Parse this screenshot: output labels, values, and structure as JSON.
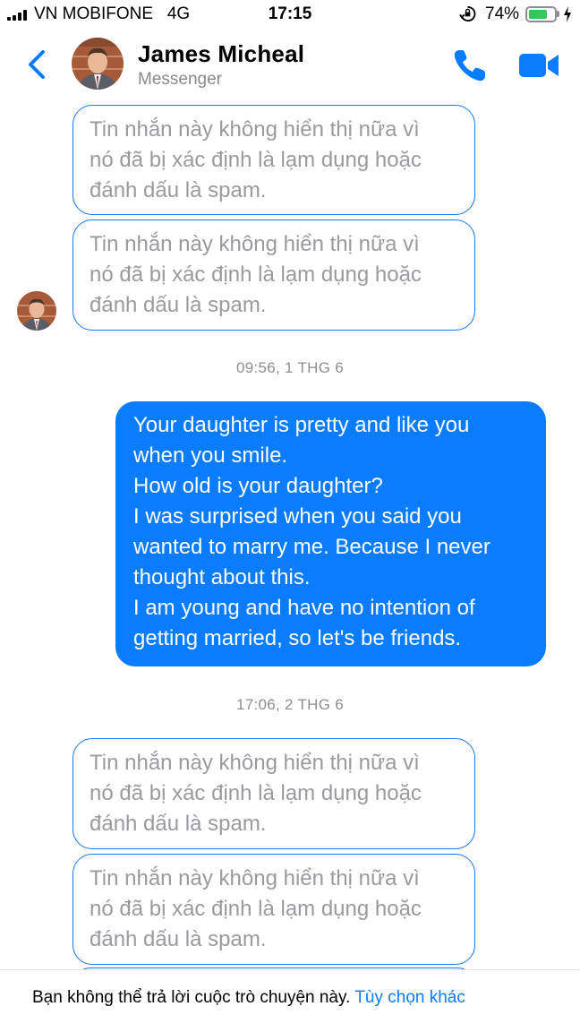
{
  "status_bar": {
    "carrier": "VN MOBIFONE",
    "network": "4G",
    "time": "17:15",
    "battery_percent": "74%",
    "battery_level": 0.74,
    "battery_color": "#34c759"
  },
  "header": {
    "contact_name": "James Micheal",
    "subtitle": "Messenger",
    "accent_color": "#0a7cff",
    "icons": [
      "chevron-left-icon",
      "phone-icon",
      "video-camera-icon"
    ]
  },
  "messages": {
    "removed_1": {
      "line1": "Tin nhắn này không hiển thị nữa vì",
      "line2": "nó đã bị xác định là lạm dụng hoặc",
      "line3": "đánh dấu là spam."
    },
    "removed_2": {
      "line1": "Tin nhắn này không hiển thị nữa vì",
      "line2": "nó đã bị xác định là lạm dụng hoặc",
      "line3": "đánh dấu là spam."
    },
    "timestamp_1": "09:56, 1 THG 6",
    "sent": {
      "lines": [
        "Your daughter is pretty and like you",
        "when you smile.",
        "How old is your daughter?",
        "I was surprised when you said you",
        "wanted to marry me. Because I never",
        "thought about this.",
        "I am young and have no intention of",
        "getting married, so let's be friends."
      ]
    },
    "timestamp_2": "17:06, 2 THG 6",
    "removed_3": {
      "line1": "Tin nhắn này không hiển thị nữa vì",
      "line2": "nó đã bị xác định là lạm dụng hoặc",
      "line3": "đánh dấu là spam."
    },
    "removed_4": {
      "line1": "Tin nhắn này không hiển thị nữa vì",
      "line2": "nó đã bị xác định là lạm dụng hoặc",
      "line3": "đánh dấu là spam."
    }
  },
  "footer": {
    "text": "Bạn không thể trả lời cuộc trò chuyện này.",
    "link": "Tùy chọn khác"
  }
}
